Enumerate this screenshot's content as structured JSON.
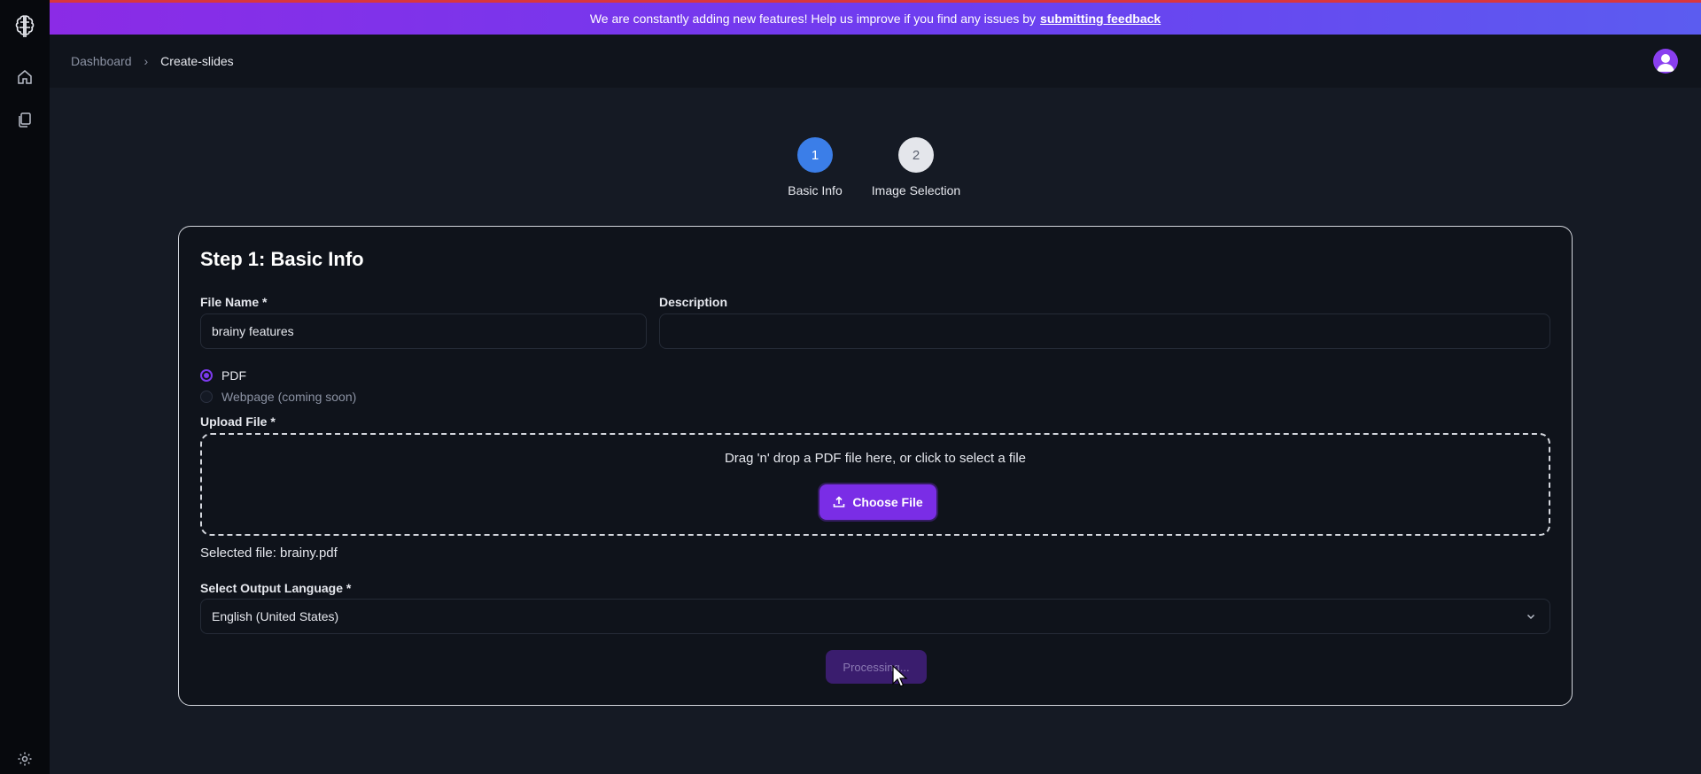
{
  "banner": {
    "text": "We are constantly adding new features! Help us improve if you find any issues by",
    "link_text": "submitting feedback"
  },
  "sidebar": {
    "icons": [
      "brain-logo-icon",
      "home-icon",
      "documents-icon",
      "settings-icon"
    ]
  },
  "breadcrumb": {
    "items": [
      "Dashboard",
      "Create-slides"
    ],
    "separator": "›"
  },
  "stepper": {
    "steps": [
      {
        "number": "1",
        "label": "Basic Info",
        "state": "active"
      },
      {
        "number": "2",
        "label": "Image Selection",
        "state": "inactive"
      }
    ]
  },
  "form": {
    "title": "Step 1: Basic Info",
    "file_name": {
      "label": "File Name *",
      "value": "brainy features"
    },
    "description": {
      "label": "Description",
      "value": ""
    },
    "source_options": [
      {
        "label": "PDF",
        "checked": true
      },
      {
        "label": "Webpage (coming soon)",
        "checked": false
      }
    ],
    "upload": {
      "label": "Upload File *",
      "prompt": "Drag 'n' drop a PDF file here, or click to select a file",
      "button_label": "Choose File"
    },
    "selected_file": "Selected file: brainy.pdf",
    "language": {
      "label": "Select Output Language *",
      "value": "English (United States)"
    },
    "submit_label": "Processing..."
  },
  "colors": {
    "accent": "#7a2de6",
    "step_active": "#3b7ee8",
    "background": "#151a24"
  }
}
